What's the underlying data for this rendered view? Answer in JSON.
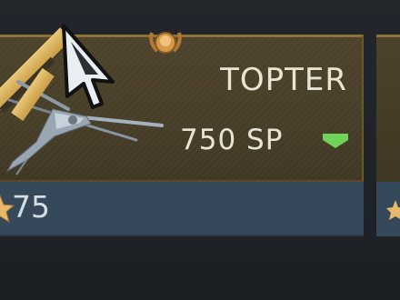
{
  "vehicle_card": {
    "name": "TOPTER",
    "cost": "750 SP",
    "stars": "75",
    "status_color": "#6fd457"
  },
  "icons": {
    "rank": "gold-rank-ribbon-icon",
    "medal": "medal-icon",
    "aircraft": "ornithopter-icon",
    "stars": "star-icon",
    "status": "green-chevron-icon",
    "cursor": "mouse-cursor-icon"
  },
  "colors": {
    "card_gold_border": "#8e7237",
    "card_body": "#473e28",
    "card_footer": "#36495a",
    "text": "#e9e4d4"
  }
}
